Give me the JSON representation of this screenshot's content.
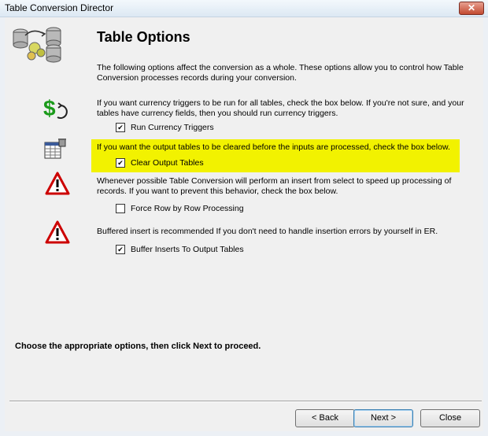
{
  "window": {
    "title": "Table Conversion Director",
    "close_label": "✕"
  },
  "page": {
    "heading": "Table Options",
    "intro": "The following options affect the conversion as a whole.  These options allow you to control how Table Conversion processes records during your conversion.",
    "sections": [
      {
        "icon": "dollar-refresh-icon",
        "text": "If you want currency triggers to be run for all tables, check the box below.  If you're not sure, and your tables have currency fields, then you should run currency triggers.",
        "checkbox_label": "Run Currency Triggers",
        "checked": true
      },
      {
        "icon": "table-trash-icon",
        "text": "If you want the output tables to be cleared before the inputs are processed, check the box below.",
        "checkbox_label": "Clear Output Tables",
        "checked": true,
        "highlight_color": "#f2f200"
      },
      {
        "icon": "warning-icon",
        "text": "Whenever possible Table Conversion will perform an insert from select to speed up processing of records.  If you want to prevent this behavior, check the box below.",
        "checkbox_label": "Force Row by Row Processing",
        "checked": false
      },
      {
        "icon": "warning-icon",
        "text": "Buffered insert is recommended If you don't need to handle insertion errors by yourself in ER.",
        "checkbox_label": "Buffer Inserts To Output Tables",
        "checked": true
      }
    ],
    "instruction": "Choose the appropriate options, then click Next to proceed."
  },
  "buttons": {
    "back": "< Back",
    "next": "Next >",
    "close": "Close"
  },
  "colors": {
    "warning": "#cc0000",
    "dollar": "#1a9a1a"
  }
}
